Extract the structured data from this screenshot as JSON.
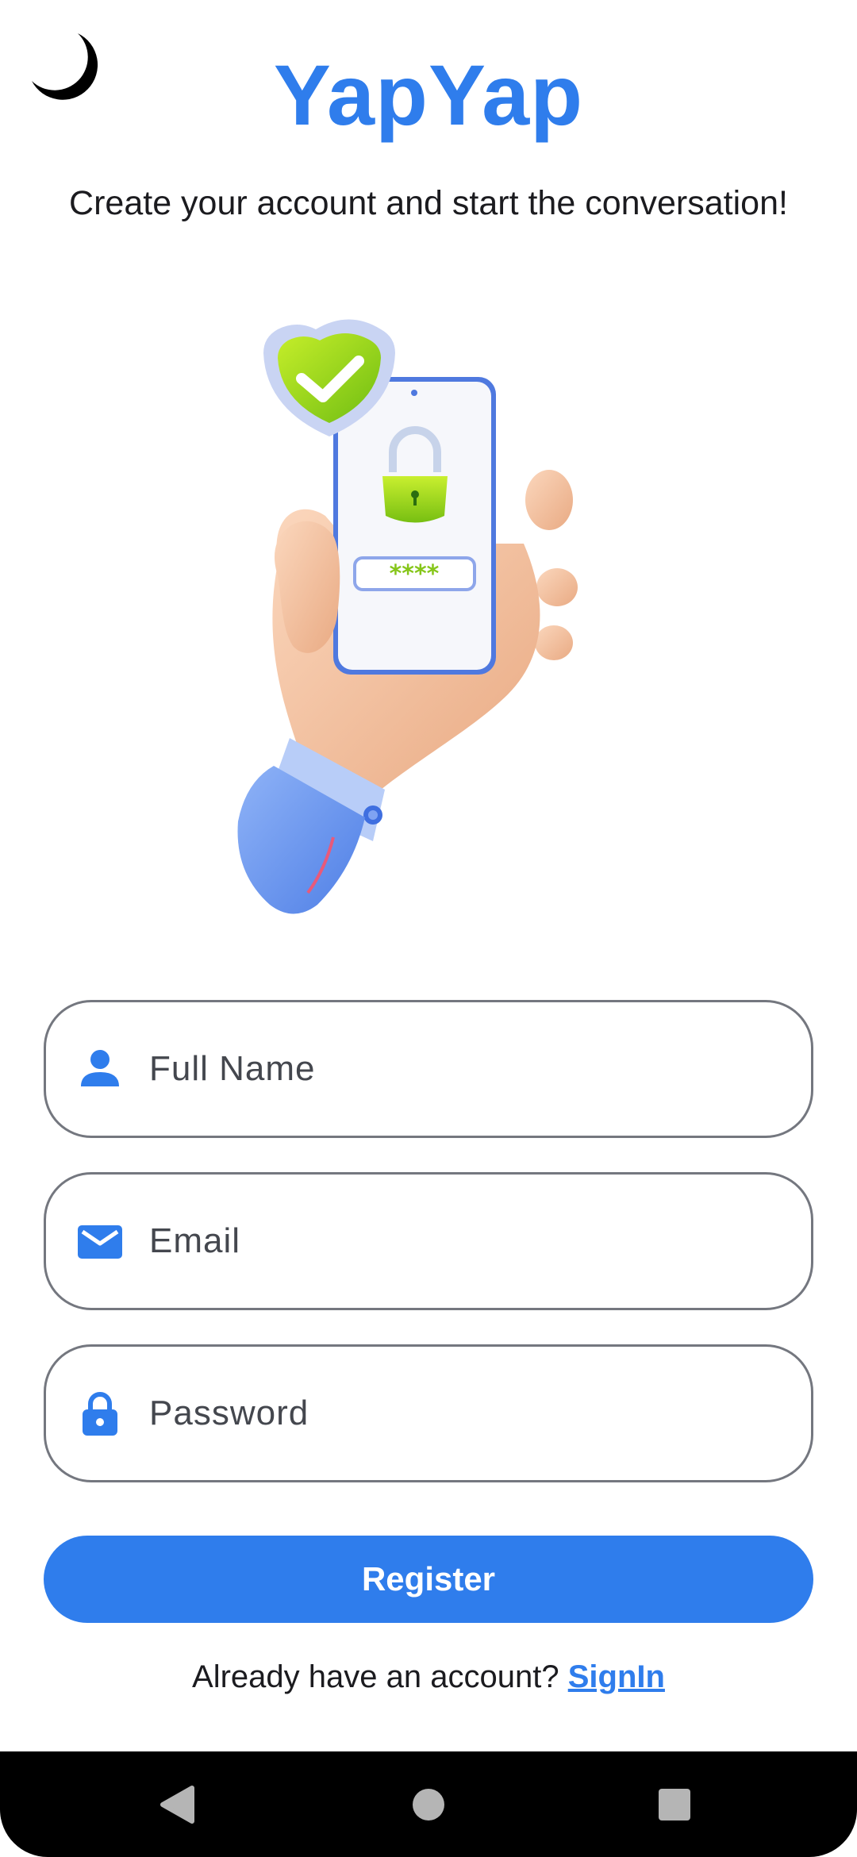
{
  "colors": {
    "accent": "#2f7dec",
    "text": "#1b1b1f",
    "border": "#74777f",
    "nav_bar": "#000000"
  },
  "header": {
    "theme_toggle_icon": "moon-icon",
    "title": "YapYap",
    "subtitle": "Create your account and start the conversation!"
  },
  "illustration": {
    "icon": "hand-holding-phone-lock-illustration",
    "password_mask": "****"
  },
  "form": {
    "full_name": {
      "placeholder": "Full Name",
      "value": "",
      "icon": "person-icon"
    },
    "email": {
      "placeholder": "Email",
      "value": "",
      "icon": "mail-icon"
    },
    "password": {
      "placeholder": "Password",
      "value": "",
      "icon": "lock-icon"
    },
    "register_label": "Register"
  },
  "footer": {
    "prompt": "Already have an account?",
    "signin_label": "SignIn"
  },
  "nav": {
    "back_icon": "back-triangle-icon",
    "home_icon": "home-circle-icon",
    "recents_icon": "recents-square-icon"
  }
}
